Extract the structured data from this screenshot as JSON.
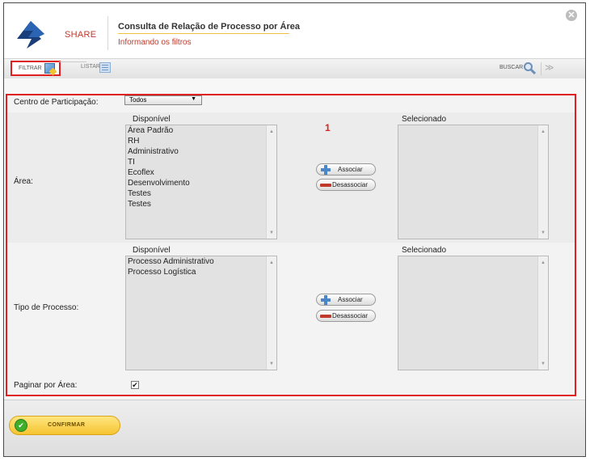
{
  "header": {
    "brand": "SHARE",
    "title": "Consulta de Relação de Processo por Área",
    "subtitle": "Informando os filtros",
    "close_glyph": "✕"
  },
  "tabs": {
    "filtrar": "FILTRAR",
    "listar": "LISTAR",
    "buscar": "BUSCAR"
  },
  "form": {
    "step_marker": "1",
    "centro": {
      "label": "Centro de Participação:",
      "value": "Todos",
      "arrow": "▼"
    },
    "area": {
      "label": "Área:",
      "available_header": "Disponível",
      "selected_header": "Selecionado",
      "available": [
        "Área Padrão",
        "RH",
        "Administrativo",
        "TI",
        "Ecoflex",
        "Desenvolvimento",
        "Testes",
        "Testes"
      ],
      "selected": [],
      "associar": "Associar",
      "desassociar": "Desassociar"
    },
    "tipo": {
      "label": "Tipo de Processo:",
      "available_header": "Disponível",
      "selected_header": "Selecionado",
      "available": [
        "Processo Administrativo",
        "Processo Logística"
      ],
      "selected": [],
      "associar": "Associar",
      "desassociar": "Desassociar"
    },
    "paginar": {
      "label": "Paginar por Área:",
      "checked": true,
      "check_glyph": "✔"
    }
  },
  "footer": {
    "confirm_label": "CONFIRMAR",
    "ok_glyph": "✔"
  },
  "colors": {
    "brand_red": "#c0392b",
    "highlight_red": "#e02020",
    "confirm_yellow": "#f5c431",
    "ok_green": "#3fae2a"
  },
  "icons": {
    "logo": "share-logo",
    "filtrar": "filter-edit-icon",
    "listar": "list-icon",
    "buscar": "magnifier-icon",
    "collapse": "chevron-double-down-icon",
    "close": "close-icon"
  }
}
